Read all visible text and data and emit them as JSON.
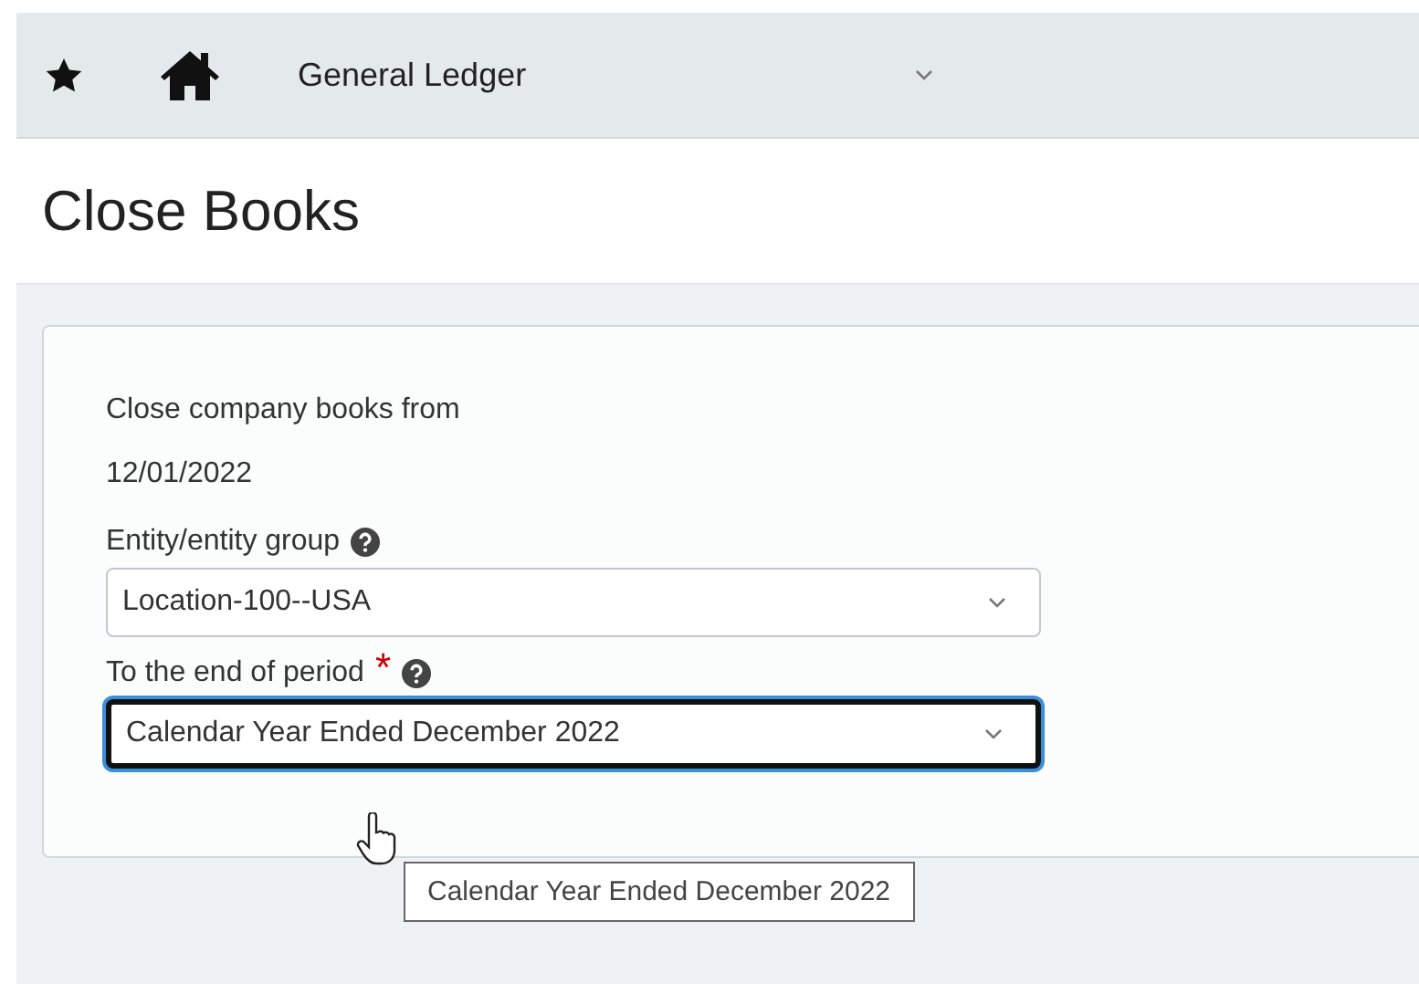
{
  "top_bar": {
    "module": "General Ledger"
  },
  "page_title": "Close Books",
  "form": {
    "from_label": "Close company books from",
    "from_value": "12/01/2022",
    "fields": [
      {
        "label": "Entity/entity group",
        "value": "Location-100--USA",
        "focused": false
      },
      {
        "label": "To the end of period",
        "required_mark": "*",
        "value": "Calendar Year Ended December 2022",
        "focused": true
      }
    ]
  },
  "tooltip": "Calendar Year Ended December 2022"
}
